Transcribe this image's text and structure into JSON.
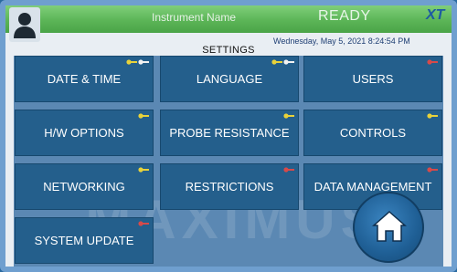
{
  "header": {
    "instrument_name": "Instrument Name",
    "status": "READY",
    "brand": "XT",
    "datetime": "Wednesday, May 5, 2021 8:24:54 PM",
    "user_icon": "user-icon"
  },
  "screen": {
    "title": "SETTINGS",
    "watermark": "MAXIMUS"
  },
  "tiles": [
    {
      "label": "DATE & TIME",
      "keys": [
        "yellow",
        "white"
      ]
    },
    {
      "label": "LANGUAGE",
      "keys": [
        "yellow",
        "white"
      ]
    },
    {
      "label": "USERS",
      "keys": [
        "red"
      ]
    },
    {
      "label": "H/W OPTIONS",
      "keys": [
        "yellow"
      ]
    },
    {
      "label": "PROBE RESISTANCE",
      "keys": [
        "yellow"
      ]
    },
    {
      "label": "CONTROLS",
      "keys": [
        "yellow"
      ]
    },
    {
      "label": "NETWORKING",
      "keys": [
        "yellow"
      ]
    },
    {
      "label": "RESTRICTIONS",
      "keys": [
        "red"
      ]
    },
    {
      "label": "DATA MANAGEMENT",
      "keys": [
        "red"
      ]
    },
    {
      "label": "SYSTEM UPDATE",
      "keys": [
        "red"
      ]
    }
  ],
  "home_button": {
    "icon": "home-icon"
  },
  "colors": {
    "key_yellow": "#e8d23a",
    "key_white": "#f2f2f2",
    "key_red": "#d64a4a",
    "tile": "#245f8c"
  }
}
